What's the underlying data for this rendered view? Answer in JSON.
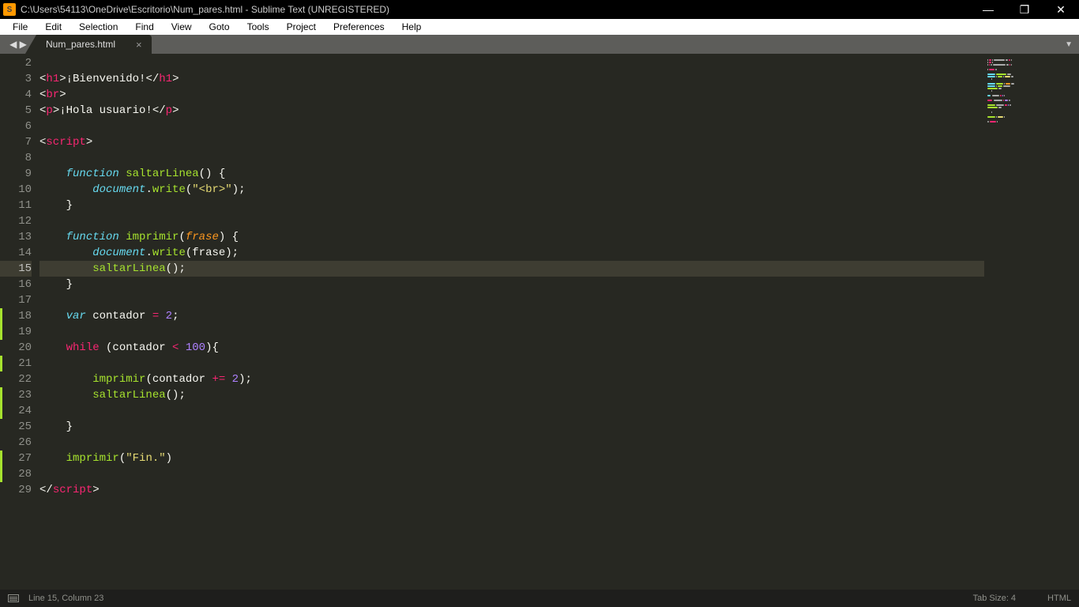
{
  "window": {
    "title": "C:\\Users\\54113\\OneDrive\\Escritorio\\Num_pares.html - Sublime Text (UNREGISTERED)"
  },
  "menu": {
    "file": "File",
    "edit": "Edit",
    "selection": "Selection",
    "find": "Find",
    "view": "View",
    "goto": "Goto",
    "tools": "Tools",
    "project": "Project",
    "preferences": "Preferences",
    "help": "Help"
  },
  "tab": {
    "name": "Num_pares.html"
  },
  "gutter": {
    "start": 2,
    "end": 29,
    "current": 15,
    "modified": [
      17,
      18,
      20,
      22,
      23,
      26,
      27
    ]
  },
  "code": {
    "lines": [
      {
        "n": 2,
        "tokens": []
      },
      {
        "n": 3,
        "tokens": [
          [
            "<",
            "c-white"
          ],
          [
            "h1",
            "c-red"
          ],
          [
            ">",
            "c-white"
          ],
          [
            "¡Bienvenido!",
            "c-white"
          ],
          [
            "</",
            "c-white"
          ],
          [
            "h1",
            "c-red"
          ],
          [
            ">",
            "c-white"
          ]
        ]
      },
      {
        "n": 4,
        "tokens": [
          [
            "<",
            "c-white"
          ],
          [
            "br",
            "c-red"
          ],
          [
            ">",
            "c-white"
          ]
        ]
      },
      {
        "n": 5,
        "tokens": [
          [
            "<",
            "c-white"
          ],
          [
            "p",
            "c-red"
          ],
          [
            ">",
            "c-white"
          ],
          [
            "¡Hola usuario!",
            "c-white"
          ],
          [
            "</",
            "c-white"
          ],
          [
            "p",
            "c-red"
          ],
          [
            ">",
            "c-white"
          ]
        ]
      },
      {
        "n": 6,
        "tokens": []
      },
      {
        "n": 7,
        "tokens": [
          [
            "<",
            "c-white"
          ],
          [
            "script",
            "c-red"
          ],
          [
            ">",
            "c-white"
          ]
        ]
      },
      {
        "n": 8,
        "tokens": []
      },
      {
        "n": 9,
        "tokens": [
          [
            "    ",
            "c-white"
          ],
          [
            "function",
            "c-blue"
          ],
          [
            " ",
            "c-white"
          ],
          [
            "saltarLinea",
            "c-green"
          ],
          [
            "() {",
            "c-white"
          ]
        ]
      },
      {
        "n": 10,
        "tokens": [
          [
            "        ",
            "c-white"
          ],
          [
            "document",
            "c-blue"
          ],
          [
            ".",
            "c-white"
          ],
          [
            "write",
            "c-green"
          ],
          [
            "(",
            "c-white"
          ],
          [
            "\"<br>\"",
            "c-yellow"
          ],
          [
            ");",
            "c-white"
          ]
        ]
      },
      {
        "n": 11,
        "tokens": [
          [
            "    }",
            "c-white"
          ]
        ]
      },
      {
        "n": 12,
        "tokens": []
      },
      {
        "n": 13,
        "tokens": [
          [
            "    ",
            "c-white"
          ],
          [
            "function",
            "c-blue"
          ],
          [
            " ",
            "c-white"
          ],
          [
            "imprimir",
            "c-green"
          ],
          [
            "(",
            "c-white"
          ],
          [
            "frase",
            "c-orange"
          ],
          [
            ") {",
            "c-white"
          ]
        ]
      },
      {
        "n": 14,
        "tokens": [
          [
            "        ",
            "c-white"
          ],
          [
            "document",
            "c-blue"
          ],
          [
            ".",
            "c-white"
          ],
          [
            "write",
            "c-green"
          ],
          [
            "(frase);",
            "c-white"
          ]
        ]
      },
      {
        "n": 15,
        "tokens": [
          [
            "        ",
            "c-white"
          ],
          [
            "saltarLinea",
            "c-green"
          ],
          [
            "();",
            "c-white"
          ]
        ]
      },
      {
        "n": 16,
        "tokens": [
          [
            "    }",
            "c-white"
          ]
        ]
      },
      {
        "n": 17,
        "tokens": []
      },
      {
        "n": 18,
        "tokens": [
          [
            "    ",
            "c-white"
          ],
          [
            "var",
            "c-blue"
          ],
          [
            " contador ",
            "c-white"
          ],
          [
            "=",
            "c-red"
          ],
          [
            " ",
            "c-white"
          ],
          [
            "2",
            "c-purple"
          ],
          [
            ";",
            "c-white"
          ]
        ]
      },
      {
        "n": 19,
        "tokens": []
      },
      {
        "n": 20,
        "tokens": [
          [
            "    ",
            "c-white"
          ],
          [
            "while",
            "c-red"
          ],
          [
            " (contador ",
            "c-white"
          ],
          [
            "<",
            "c-red"
          ],
          [
            " ",
            "c-white"
          ],
          [
            "100",
            "c-purple"
          ],
          [
            "){",
            "c-white"
          ]
        ]
      },
      {
        "n": 21,
        "tokens": []
      },
      {
        "n": 22,
        "tokens": [
          [
            "        ",
            "c-white"
          ],
          [
            "imprimir",
            "c-green"
          ],
          [
            "(contador ",
            "c-white"
          ],
          [
            "+=",
            "c-red"
          ],
          [
            " ",
            "c-white"
          ],
          [
            "2",
            "c-purple"
          ],
          [
            ");",
            "c-white"
          ]
        ]
      },
      {
        "n": 23,
        "tokens": [
          [
            "        ",
            "c-white"
          ],
          [
            "saltarLinea",
            "c-green"
          ],
          [
            "();",
            "c-white"
          ]
        ]
      },
      {
        "n": 24,
        "tokens": []
      },
      {
        "n": 25,
        "tokens": [
          [
            "    }",
            "c-white"
          ]
        ]
      },
      {
        "n": 26,
        "tokens": []
      },
      {
        "n": 27,
        "tokens": [
          [
            "    ",
            "c-white"
          ],
          [
            "imprimir",
            "c-green"
          ],
          [
            "(",
            "c-white"
          ],
          [
            "\"Fin.\"",
            "c-yellow"
          ],
          [
            ")",
            "c-white"
          ]
        ]
      },
      {
        "n": 28,
        "tokens": []
      },
      {
        "n": 29,
        "tokens": [
          [
            "</",
            "c-white"
          ],
          [
            "script",
            "c-red"
          ],
          [
            ">",
            "c-white"
          ]
        ]
      }
    ]
  },
  "statusbar": {
    "position": "Line 15, Column 23",
    "tabsize": "Tab Size: 4",
    "syntax": "HTML"
  }
}
